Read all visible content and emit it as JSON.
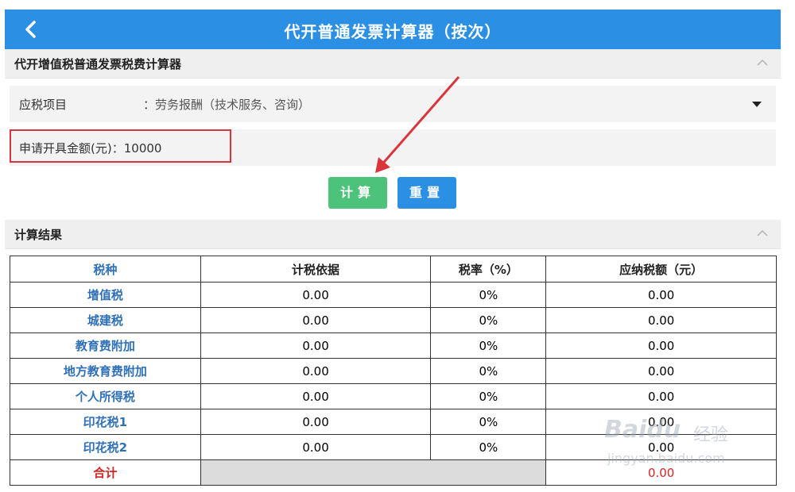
{
  "header": {
    "title": "代开普通发票计算器（按次）",
    "back_icon": "chevron-left-icon"
  },
  "calculator_section": {
    "title": "代开增值税普通发票税费计算器",
    "tax_item": {
      "label": "应税项目",
      "colon": "：",
      "value": "劳务报酬（技术服务、咨询）"
    },
    "amount": {
      "label": "申请开具金额(元)",
      "colon": "：",
      "value": "10000"
    },
    "buttons": {
      "calculate": "计算",
      "reset": "重置"
    }
  },
  "result_section": {
    "title": "计算结果",
    "headers": [
      "税种",
      "计税依据",
      "税率（%）",
      "应纳税额（元）"
    ],
    "rows": [
      {
        "name": "增值税",
        "basis": "0.00",
        "rate": "0%",
        "amount": "0.00"
      },
      {
        "name": "城建税",
        "basis": "0.00",
        "rate": "0%",
        "amount": "0.00"
      },
      {
        "name": "教育费附加",
        "basis": "0.00",
        "rate": "0%",
        "amount": "0.00"
      },
      {
        "name": "地方教育费附加",
        "basis": "0.00",
        "rate": "0%",
        "amount": "0.00"
      },
      {
        "name": "个人所得税",
        "basis": "0.00",
        "rate": "0%",
        "amount": "0.00"
      },
      {
        "name": "印花税1",
        "basis": "0.00",
        "rate": "0%",
        "amount": "0.00"
      },
      {
        "name": "印花税2",
        "basis": "0.00",
        "rate": "0%",
        "amount": "0.00"
      }
    ],
    "total": {
      "name": "合计",
      "amount": "0.00"
    }
  },
  "watermark": {
    "brand": "Baidu",
    "sub": "经验",
    "url": "jingyan.baidu.com"
  },
  "colors": {
    "header": "#2b8fe3",
    "calculate": "#4cc27a",
    "reset": "#2b8fe3",
    "highlight": "#d9353b",
    "tax_name": "#2f70b7",
    "total": "#d62424"
  }
}
